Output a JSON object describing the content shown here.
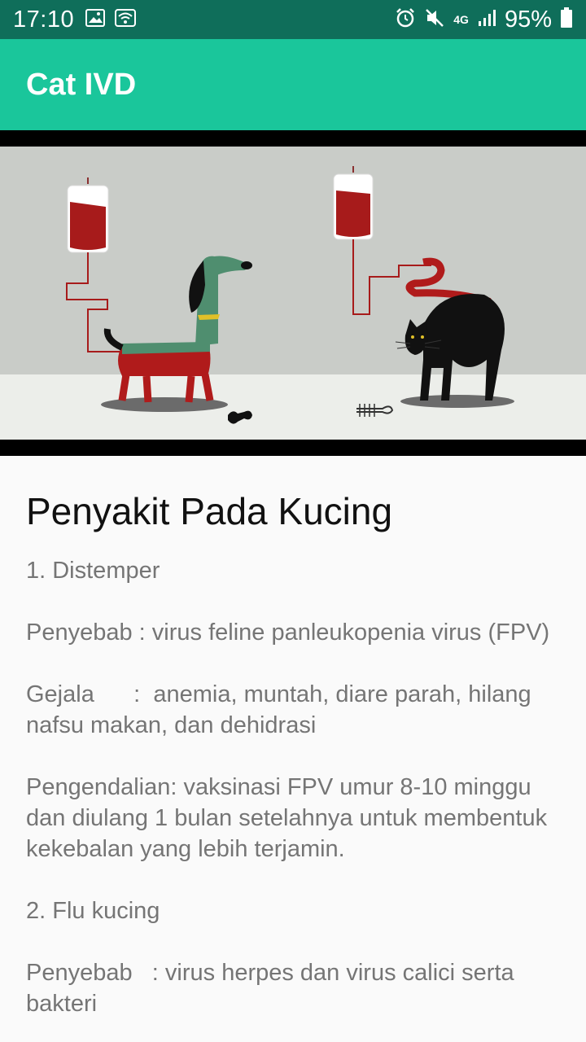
{
  "status_bar": {
    "time": "17:10",
    "battery": "95%",
    "network": "4G",
    "icons": [
      "image-icon",
      "wifi-icon",
      "alarm-icon",
      "mute-icon",
      "signal-icon",
      "battery-icon"
    ]
  },
  "app_bar": {
    "title": "Cat IVD"
  },
  "hero": {
    "image": "illustration of a dog and a cat each connected to an IV blood bag"
  },
  "article": {
    "heading": "Penyakit Pada Kucing",
    "sections": [
      {
        "title": "1.  Distemper",
        "cause_label": "Penyebab : ",
        "cause": "virus feline panleukopenia virus (FPV)",
        "symptom_label": "Gejala      :  ",
        "symptom": "anemia, muntah, diare parah, hilang nafsu makan, dan dehidrasi",
        "control_label": "Pengendalian: ",
        "control": "vaksinasi FPV umur 8-10 minggu dan diulang 1 bulan setelahnya untuk membentuk kekebalan yang lebih terjamin."
      },
      {
        "title": "2.  Flu kucing",
        "cause_label": "Penyebab   : ",
        "cause": "virus herpes dan virus calici serta bakteri"
      }
    ]
  },
  "colors": {
    "status_bar": "#0f6e5a",
    "app_bar": "#1ac69b",
    "body_text": "#757575",
    "heading": "#111111"
  }
}
